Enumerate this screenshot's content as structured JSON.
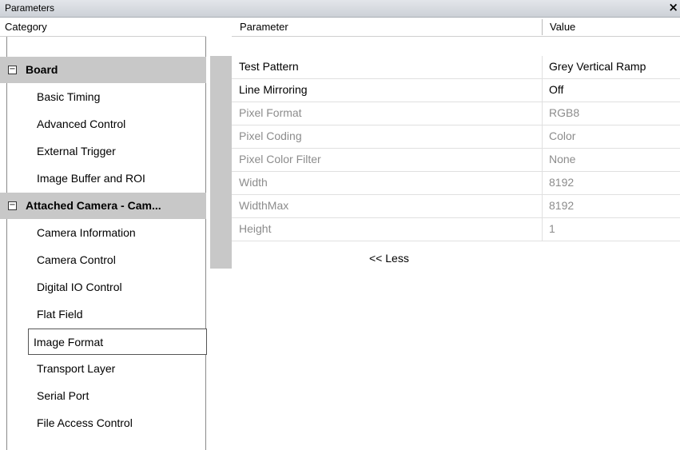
{
  "window": {
    "title": "Parameters",
    "close_glyph": "×"
  },
  "header": {
    "category": "Category",
    "parameter": "Parameter",
    "value": "Value"
  },
  "categories": [
    {
      "label": "Board",
      "type": "group",
      "expander": "−"
    },
    {
      "label": "Basic Timing",
      "type": "item"
    },
    {
      "label": "Advanced Control",
      "type": "item"
    },
    {
      "label": "External Trigger",
      "type": "item"
    },
    {
      "label": "Image Buffer and ROI",
      "type": "item"
    },
    {
      "label": "Attached Camera - Cam...",
      "type": "group",
      "expander": "−"
    },
    {
      "label": "Camera Information",
      "type": "item"
    },
    {
      "label": "Camera Control",
      "type": "item"
    },
    {
      "label": "Digital IO Control",
      "type": "item"
    },
    {
      "label": "Flat Field",
      "type": "item"
    },
    {
      "label": "Image Format",
      "type": "item",
      "selected": true
    },
    {
      "label": "Transport Layer",
      "type": "item"
    },
    {
      "label": "Serial Port",
      "type": "item"
    },
    {
      "label": "File Access Control",
      "type": "item"
    }
  ],
  "parameters": [
    {
      "name": "Test Pattern",
      "value": "Grey Vertical Ramp",
      "enabled": true
    },
    {
      "name": "Line Mirroring",
      "value": "Off",
      "enabled": true
    },
    {
      "name": "Pixel Format",
      "value": "RGB8",
      "enabled": false
    },
    {
      "name": "Pixel Coding",
      "value": "Color",
      "enabled": false
    },
    {
      "name": "Pixel Color Filter",
      "value": "None",
      "enabled": false
    },
    {
      "name": "Width",
      "value": "8192",
      "enabled": false
    },
    {
      "name": "WidthMax",
      "value": "8192",
      "enabled": false
    },
    {
      "name": "Height",
      "value": "1",
      "enabled": false
    }
  ],
  "less_link": "<< Less"
}
